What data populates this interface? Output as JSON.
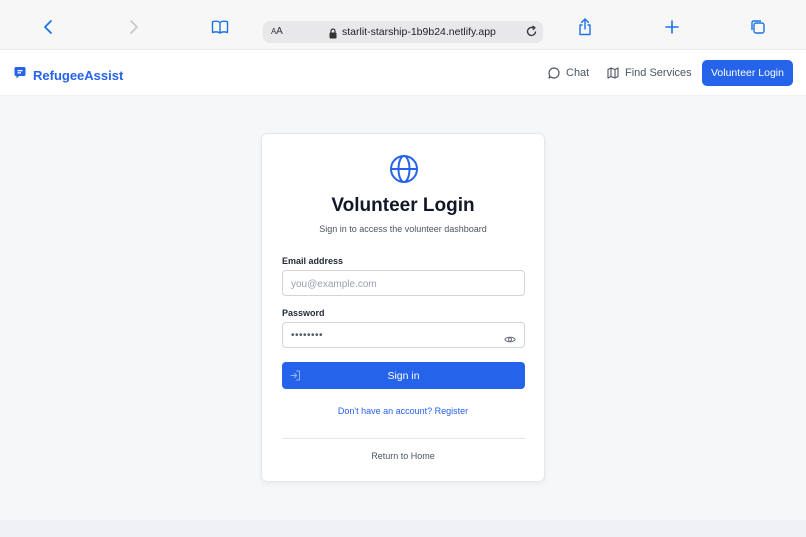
{
  "browser": {
    "text_size_label": "AA",
    "url": "starlit-starship-1b9b24.netlify.app"
  },
  "nav": {
    "brand": "RefugeeAssist",
    "chat": "Chat",
    "find_services": "Find Services",
    "volunteer_login": "Volunteer Login"
  },
  "login": {
    "title": "Volunteer Login",
    "subtitle": "Sign in to access the volunteer dashboard",
    "email_label": "Email address",
    "email_placeholder": "you@example.com",
    "password_label": "Password",
    "password_value": "••••••••",
    "sign_in": "Sign in",
    "register": "Don't have an account? Register",
    "return_home": "Return to Home"
  },
  "colors": {
    "primary": "#2563eb",
    "ios_blue": "#1a73e8"
  }
}
